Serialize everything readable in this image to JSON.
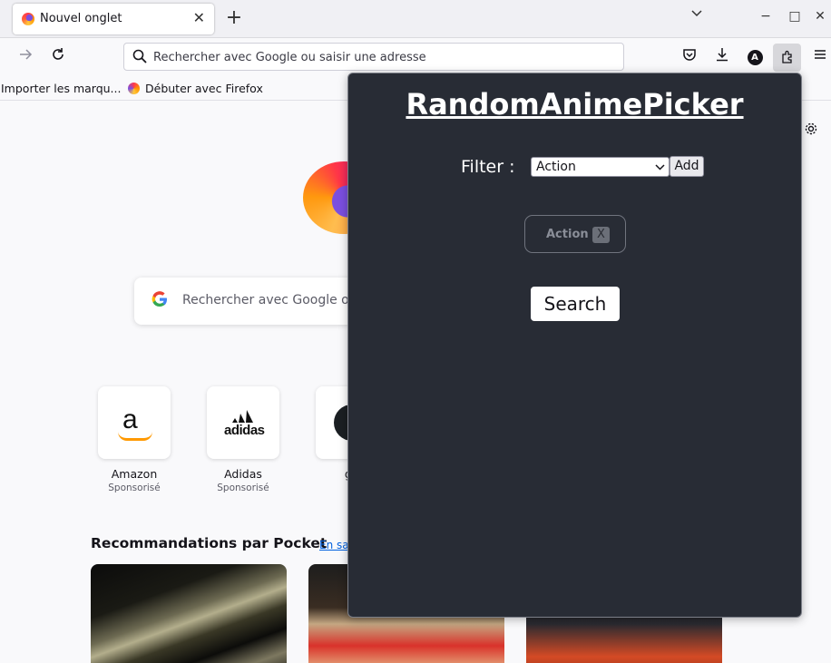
{
  "browser": {
    "tab": {
      "title": "Nouvel onglet",
      "close": "✕"
    },
    "new_tab": "+",
    "window_controls": {
      "list_tabs": "⌄",
      "minimize": "−",
      "maximize": "□",
      "close": "✕"
    },
    "urlbar": {
      "placeholder": "Rechercher avec Google ou saisir une adresse"
    },
    "toolbar_icons": [
      "back-arrow-icon",
      "reload-icon",
      "pocket-icon",
      "download-icon",
      "account-icon",
      "extensions-icon",
      "menu-icon"
    ],
    "account_initial": "A",
    "bookmarks": [
      {
        "label": "Importer les marqu..."
      },
      {
        "label": "Débuter avec Firefox"
      }
    ]
  },
  "newtab": {
    "search_placeholder": "Rechercher avec Google ou",
    "shortcuts": [
      {
        "title": "Amazon",
        "sub": "Sponsorisé"
      },
      {
        "title": "Adidas",
        "sub": "Sponsorisé"
      },
      {
        "title": "git",
        "sub": ""
      }
    ],
    "pocket": {
      "title": "Recommandations par Pocket",
      "link": "En sa"
    }
  },
  "popup": {
    "title": "RandomAnimePicker",
    "filter_label": "Filter :",
    "filter_selected": "Action",
    "add_label": "Add",
    "tags": [
      {
        "label": "Action",
        "remove": "X"
      }
    ],
    "search_label": "Search"
  }
}
